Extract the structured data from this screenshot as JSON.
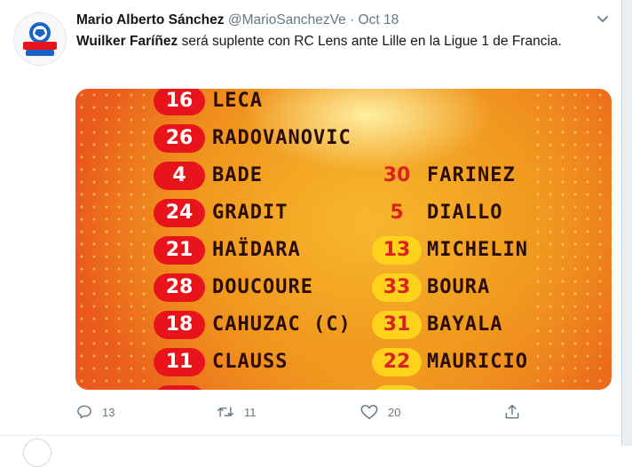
{
  "tweet": {
    "author_name": "Mario Alberto Sánchez",
    "handle": "@MarioSanchezVe",
    "separator": "·",
    "date": "Oct 18",
    "text_bold": "Wuilker Faríñez",
    "text_rest": " será suplente con RC Lens ante Lille en la Ligue 1 de Francia."
  },
  "lineup": {
    "starters": [
      {
        "number": "16",
        "name": "LECA"
      },
      {
        "number": "26",
        "name": "RADOVANOVIC"
      },
      {
        "number": "4",
        "name": "BADE"
      },
      {
        "number": "24",
        "name": "GRADIT"
      },
      {
        "number": "21",
        "name": "HAÏDARA"
      },
      {
        "number": "28",
        "name": "DOUCOURE"
      },
      {
        "number": "18",
        "name": "CAHUZAC (C)"
      },
      {
        "number": "11",
        "name": "CLAUSS"
      }
    ],
    "subs": [
      {
        "number": "30",
        "name": "FARINEZ"
      },
      {
        "number": "5",
        "name": "DIALLO"
      },
      {
        "number": "13",
        "name": "MICHELIN"
      },
      {
        "number": "33",
        "name": "BOURA"
      },
      {
        "number": "31",
        "name": "BAYALA"
      },
      {
        "number": "22",
        "name": "MAURICIO"
      }
    ]
  },
  "actions": {
    "reply_count": "13",
    "retweet_count": "11",
    "like_count": "20"
  },
  "icons": {
    "reply": "reply-icon",
    "retweet": "retweet-icon",
    "like": "heart-icon",
    "share": "share-icon",
    "caret": "chevron-down-icon"
  },
  "colors": {
    "red_badge": "#e8131b",
    "yellow_badge": "#ffd21c",
    "text_gray": "#657786"
  }
}
